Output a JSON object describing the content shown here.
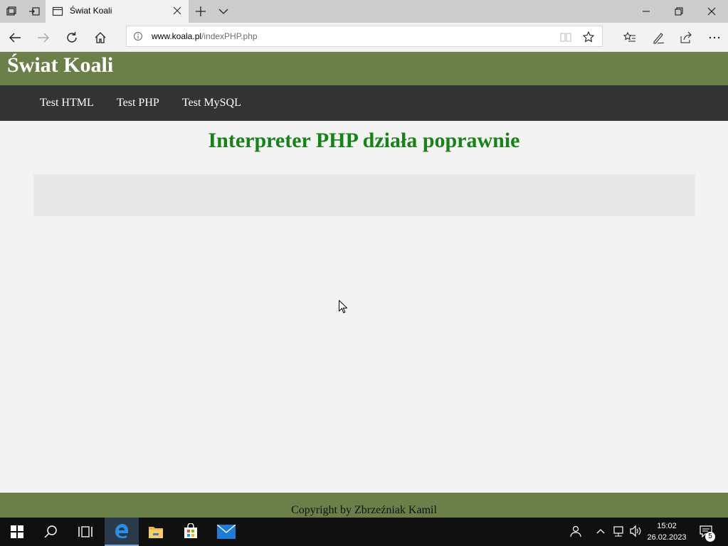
{
  "browser": {
    "tab_title": "Świat Koali",
    "url_domain": "www.koala.pl",
    "url_path": "/indexPHP.php"
  },
  "page": {
    "site_title": "Świat Koali",
    "nav": [
      {
        "label": "Test HTML"
      },
      {
        "label": "Test PHP"
      },
      {
        "label": "Test MySQL"
      }
    ],
    "heading": "Interpreter PHP działa poprawnie",
    "footer": "Copyright by Zbrzeźniak Kamil",
    "colors": {
      "header_bg": "#6a8048",
      "nav_bg": "#333333",
      "heading": "#178217",
      "page_bg": "#f3f3f3"
    }
  },
  "taskbar": {
    "time": "15:02",
    "date": "26.02.2023",
    "notification_count": "5",
    "pinned": [
      "start-icon",
      "search-icon",
      "task-view-icon",
      "edge-icon",
      "file-explorer-icon",
      "store-icon",
      "mail-icon"
    ]
  }
}
